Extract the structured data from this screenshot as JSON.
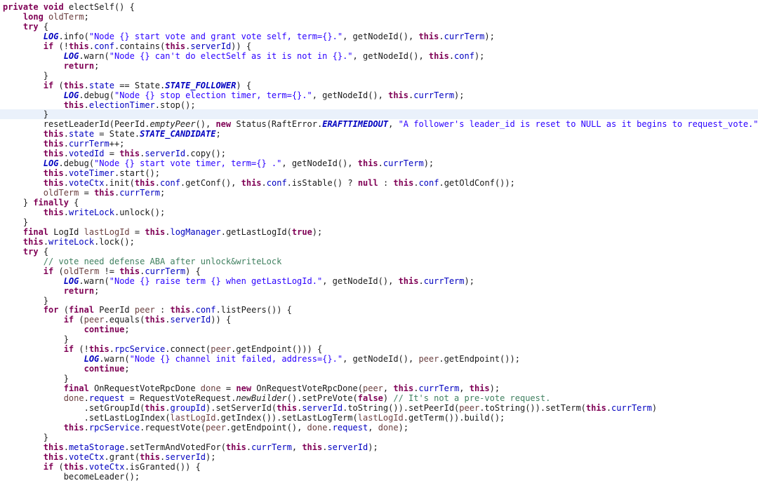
{
  "editor": {
    "language": "java",
    "highlighted_line": 11,
    "colors": {
      "keyword": "#7f0055",
      "field": "#0000c0",
      "string": "#2a00ff",
      "comment": "#3f7f5f",
      "local_variable": "#6a3e3e",
      "current_line": "#eaf1fb"
    },
    "lines": [
      [
        [
          "kw",
          "private void "
        ],
        [
          "pl",
          "electSelf() {"
        ]
      ],
      [
        [
          "pl",
          "    "
        ],
        [
          "kw",
          "long "
        ],
        [
          "lv",
          "oldTerm"
        ],
        [
          "pl",
          ";"
        ]
      ],
      [
        [
          "pl",
          "    "
        ],
        [
          "kw",
          "try "
        ],
        [
          "pl",
          "{"
        ]
      ],
      [
        [
          "pl",
          "        "
        ],
        [
          "sfld",
          "LOG"
        ],
        [
          "pl",
          ".info("
        ],
        [
          "str",
          "\"Node {} start vote and grant vote self, term={}.\""
        ],
        [
          "pl",
          ", getNodeId(), "
        ],
        [
          "kw",
          "this"
        ],
        [
          "pl",
          "."
        ],
        [
          "fld",
          "currTerm"
        ],
        [
          "pl",
          ");"
        ]
      ],
      [
        [
          "pl",
          "        "
        ],
        [
          "kw",
          "if "
        ],
        [
          "pl",
          "(!"
        ],
        [
          "kw",
          "this"
        ],
        [
          "pl",
          "."
        ],
        [
          "fld",
          "conf"
        ],
        [
          "pl",
          ".contains("
        ],
        [
          "kw",
          "this"
        ],
        [
          "pl",
          "."
        ],
        [
          "fld",
          "serverId"
        ],
        [
          "pl",
          ")) {"
        ]
      ],
      [
        [
          "pl",
          "            "
        ],
        [
          "sfld",
          "LOG"
        ],
        [
          "pl",
          ".warn("
        ],
        [
          "str",
          "\"Node {} can't do electSelf as it is not in {}.\""
        ],
        [
          "pl",
          ", getNodeId(), "
        ],
        [
          "kw",
          "this"
        ],
        [
          "pl",
          "."
        ],
        [
          "fld",
          "conf"
        ],
        [
          "pl",
          ");"
        ]
      ],
      [
        [
          "pl",
          "            "
        ],
        [
          "kw",
          "return"
        ],
        [
          "pl",
          ";"
        ]
      ],
      [
        [
          "pl",
          "        }"
        ]
      ],
      [
        [
          "pl",
          "        "
        ],
        [
          "kw",
          "if "
        ],
        [
          "pl",
          "("
        ],
        [
          "kw",
          "this"
        ],
        [
          "pl",
          "."
        ],
        [
          "fld",
          "state"
        ],
        [
          "pl",
          " == State."
        ],
        [
          "sfld",
          "STATE_FOLLOWER"
        ],
        [
          "pl",
          ") {"
        ]
      ],
      [
        [
          "pl",
          "            "
        ],
        [
          "sfld",
          "LOG"
        ],
        [
          "pl",
          ".debug("
        ],
        [
          "str",
          "\"Node {} stop election timer, term={}.\""
        ],
        [
          "pl",
          ", getNodeId(), "
        ],
        [
          "kw",
          "this"
        ],
        [
          "pl",
          "."
        ],
        [
          "fld",
          "currTerm"
        ],
        [
          "pl",
          ");"
        ]
      ],
      [
        [
          "pl",
          "            "
        ],
        [
          "kw",
          "this"
        ],
        [
          "pl",
          "."
        ],
        [
          "fld",
          "electionTimer"
        ],
        [
          "pl",
          ".stop();"
        ]
      ],
      [
        [
          "pl",
          "        }"
        ]
      ],
      [
        [
          "pl",
          "        resetLeaderId(PeerId."
        ],
        [
          "it",
          "emptyPeer"
        ],
        [
          "pl",
          "(), "
        ],
        [
          "kw",
          "new "
        ],
        [
          "pl",
          "Status(RaftError."
        ],
        [
          "sfld",
          "ERAFTTIMEDOUT"
        ],
        [
          "pl",
          ", "
        ],
        [
          "str",
          "\"A follower's leader_id is reset to NULL as it begins to request_vote.\""
        ],
        [
          "pl",
          "));"
        ]
      ],
      [
        [
          "pl",
          "        "
        ],
        [
          "kw",
          "this"
        ],
        [
          "pl",
          "."
        ],
        [
          "fld",
          "state"
        ],
        [
          "pl",
          " = State."
        ],
        [
          "sfld",
          "STATE_CANDIDATE"
        ],
        [
          "pl",
          ";"
        ]
      ],
      [
        [
          "pl",
          "        "
        ],
        [
          "kw",
          "this"
        ],
        [
          "pl",
          "."
        ],
        [
          "fld",
          "currTerm"
        ],
        [
          "pl",
          "++;"
        ]
      ],
      [
        [
          "pl",
          "        "
        ],
        [
          "kw",
          "this"
        ],
        [
          "pl",
          "."
        ],
        [
          "fld",
          "votedId"
        ],
        [
          "pl",
          " = "
        ],
        [
          "kw",
          "this"
        ],
        [
          "pl",
          "."
        ],
        [
          "fld",
          "serverId"
        ],
        [
          "pl",
          ".copy();"
        ]
      ],
      [
        [
          "pl",
          "        "
        ],
        [
          "sfld",
          "LOG"
        ],
        [
          "pl",
          ".debug("
        ],
        [
          "str",
          "\"Node {} start vote timer, term={} .\""
        ],
        [
          "pl",
          ", getNodeId(), "
        ],
        [
          "kw",
          "this"
        ],
        [
          "pl",
          "."
        ],
        [
          "fld",
          "currTerm"
        ],
        [
          "pl",
          ");"
        ]
      ],
      [
        [
          "pl",
          "        "
        ],
        [
          "kw",
          "this"
        ],
        [
          "pl",
          "."
        ],
        [
          "fld",
          "voteTimer"
        ],
        [
          "pl",
          ".start();"
        ]
      ],
      [
        [
          "pl",
          "        "
        ],
        [
          "kw",
          "this"
        ],
        [
          "pl",
          "."
        ],
        [
          "fld",
          "voteCtx"
        ],
        [
          "pl",
          ".init("
        ],
        [
          "kw",
          "this"
        ],
        [
          "pl",
          "."
        ],
        [
          "fld",
          "conf"
        ],
        [
          "pl",
          ".getConf(), "
        ],
        [
          "kw",
          "this"
        ],
        [
          "pl",
          "."
        ],
        [
          "fld",
          "conf"
        ],
        [
          "pl",
          ".isStable() ? "
        ],
        [
          "kw",
          "null"
        ],
        [
          "pl",
          " : "
        ],
        [
          "kw",
          "this"
        ],
        [
          "pl",
          "."
        ],
        [
          "fld",
          "conf"
        ],
        [
          "pl",
          ".getOldConf());"
        ]
      ],
      [
        [
          "pl",
          "        "
        ],
        [
          "lv",
          "oldTerm"
        ],
        [
          "pl",
          " = "
        ],
        [
          "kw",
          "this"
        ],
        [
          "pl",
          "."
        ],
        [
          "fld",
          "currTerm"
        ],
        [
          "pl",
          ";"
        ]
      ],
      [
        [
          "pl",
          "    } "
        ],
        [
          "kw",
          "finally "
        ],
        [
          "pl",
          "{"
        ]
      ],
      [
        [
          "pl",
          "        "
        ],
        [
          "kw",
          "this"
        ],
        [
          "pl",
          "."
        ],
        [
          "fld",
          "writeLock"
        ],
        [
          "pl",
          ".unlock();"
        ]
      ],
      [
        [
          "pl",
          "    }"
        ]
      ],
      [
        [
          "pl",
          "    "
        ],
        [
          "kw",
          "final "
        ],
        [
          "pl",
          "LogId "
        ],
        [
          "lv",
          "lastLogId"
        ],
        [
          "pl",
          " = "
        ],
        [
          "kw",
          "this"
        ],
        [
          "pl",
          "."
        ],
        [
          "fld",
          "logManager"
        ],
        [
          "pl",
          ".getLastLogId("
        ],
        [
          "kw",
          "true"
        ],
        [
          "pl",
          ");"
        ]
      ],
      [
        [
          "pl",
          "    "
        ],
        [
          "kw",
          "this"
        ],
        [
          "pl",
          "."
        ],
        [
          "fld",
          "writeLock"
        ],
        [
          "pl",
          ".lock();"
        ]
      ],
      [
        [
          "pl",
          "    "
        ],
        [
          "kw",
          "try "
        ],
        [
          "pl",
          "{"
        ]
      ],
      [
        [
          "pl",
          "        "
        ],
        [
          "cm",
          "// vote need defense ABA after unlock&writeLock"
        ]
      ],
      [
        [
          "pl",
          "        "
        ],
        [
          "kw",
          "if "
        ],
        [
          "pl",
          "("
        ],
        [
          "lv",
          "oldTerm"
        ],
        [
          "pl",
          " != "
        ],
        [
          "kw",
          "this"
        ],
        [
          "pl",
          "."
        ],
        [
          "fld",
          "currTerm"
        ],
        [
          "pl",
          ") {"
        ]
      ],
      [
        [
          "pl",
          "            "
        ],
        [
          "sfld",
          "LOG"
        ],
        [
          "pl",
          ".warn("
        ],
        [
          "str",
          "\"Node {} raise term {} when getLastLogId.\""
        ],
        [
          "pl",
          ", getNodeId(), "
        ],
        [
          "kw",
          "this"
        ],
        [
          "pl",
          "."
        ],
        [
          "fld",
          "currTerm"
        ],
        [
          "pl",
          ");"
        ]
      ],
      [
        [
          "pl",
          "            "
        ],
        [
          "kw",
          "return"
        ],
        [
          "pl",
          ";"
        ]
      ],
      [
        [
          "pl",
          "        }"
        ]
      ],
      [
        [
          "pl",
          "        "
        ],
        [
          "kw",
          "for "
        ],
        [
          "pl",
          "("
        ],
        [
          "kw",
          "final "
        ],
        [
          "pl",
          "PeerId "
        ],
        [
          "lv",
          "peer"
        ],
        [
          "pl",
          " : "
        ],
        [
          "kw",
          "this"
        ],
        [
          "pl",
          "."
        ],
        [
          "fld",
          "conf"
        ],
        [
          "pl",
          ".listPeers()) {"
        ]
      ],
      [
        [
          "pl",
          "            "
        ],
        [
          "kw",
          "if "
        ],
        [
          "pl",
          "("
        ],
        [
          "lv",
          "peer"
        ],
        [
          "pl",
          ".equals("
        ],
        [
          "kw",
          "this"
        ],
        [
          "pl",
          "."
        ],
        [
          "fld",
          "serverId"
        ],
        [
          "pl",
          ")) {"
        ]
      ],
      [
        [
          "pl",
          "                "
        ],
        [
          "kw",
          "continue"
        ],
        [
          "pl",
          ";"
        ]
      ],
      [
        [
          "pl",
          "            }"
        ]
      ],
      [
        [
          "pl",
          "            "
        ],
        [
          "kw",
          "if "
        ],
        [
          "pl",
          "(!"
        ],
        [
          "kw",
          "this"
        ],
        [
          "pl",
          "."
        ],
        [
          "fld",
          "rpcService"
        ],
        [
          "pl",
          ".connect("
        ],
        [
          "lv",
          "peer"
        ],
        [
          "pl",
          ".getEndpoint())) {"
        ]
      ],
      [
        [
          "pl",
          "                "
        ],
        [
          "sfld",
          "LOG"
        ],
        [
          "pl",
          ".warn("
        ],
        [
          "str",
          "\"Node {} channel init failed, address={}.\""
        ],
        [
          "pl",
          ", getNodeId(), "
        ],
        [
          "lv",
          "peer"
        ],
        [
          "pl",
          ".getEndpoint());"
        ]
      ],
      [
        [
          "pl",
          "                "
        ],
        [
          "kw",
          "continue"
        ],
        [
          "pl",
          ";"
        ]
      ],
      [
        [
          "pl",
          "            }"
        ]
      ],
      [
        [
          "pl",
          "            "
        ],
        [
          "kw",
          "final "
        ],
        [
          "pl",
          "OnRequestVoteRpcDone "
        ],
        [
          "lv",
          "done"
        ],
        [
          "pl",
          " = "
        ],
        [
          "kw",
          "new "
        ],
        [
          "pl",
          "OnRequestVoteRpcDone("
        ],
        [
          "lv",
          "peer"
        ],
        [
          "pl",
          ", "
        ],
        [
          "kw",
          "this"
        ],
        [
          "pl",
          "."
        ],
        [
          "fld",
          "currTerm"
        ],
        [
          "pl",
          ", "
        ],
        [
          "kw",
          "this"
        ],
        [
          "pl",
          ");"
        ]
      ],
      [
        [
          "pl",
          "            "
        ],
        [
          "lv",
          "done"
        ],
        [
          "pl",
          "."
        ],
        [
          "fld",
          "request"
        ],
        [
          "pl",
          " = RequestVoteRequest."
        ],
        [
          "it",
          "newBuilder"
        ],
        [
          "pl",
          "().setPreVote("
        ],
        [
          "kw",
          "false"
        ],
        [
          "pl",
          ") "
        ],
        [
          "cm",
          "// It's not a pre-vote request."
        ]
      ],
      [
        [
          "pl",
          "                .setGroupId("
        ],
        [
          "kw",
          "this"
        ],
        [
          "pl",
          "."
        ],
        [
          "fld",
          "groupId"
        ],
        [
          "pl",
          ").setServerId("
        ],
        [
          "kw",
          "this"
        ],
        [
          "pl",
          "."
        ],
        [
          "fld",
          "serverId"
        ],
        [
          "pl",
          ".toString()).setPeerId("
        ],
        [
          "lv",
          "peer"
        ],
        [
          "pl",
          ".toString()).setTerm("
        ],
        [
          "kw",
          "this"
        ],
        [
          "pl",
          "."
        ],
        [
          "fld",
          "currTerm"
        ],
        [
          "pl",
          ")"
        ]
      ],
      [
        [
          "pl",
          "                .setLastLogIndex("
        ],
        [
          "lv",
          "lastLogId"
        ],
        [
          "pl",
          ".getIndex()).setLastLogTerm("
        ],
        [
          "lv",
          "lastLogId"
        ],
        [
          "pl",
          ".getTerm()).build();"
        ]
      ],
      [
        [
          "pl",
          "            "
        ],
        [
          "kw",
          "this"
        ],
        [
          "pl",
          "."
        ],
        [
          "fld",
          "rpcService"
        ],
        [
          "pl",
          ".requestVote("
        ],
        [
          "lv",
          "peer"
        ],
        [
          "pl",
          ".getEndpoint(), "
        ],
        [
          "lv",
          "done"
        ],
        [
          "pl",
          "."
        ],
        [
          "fld",
          "request"
        ],
        [
          "pl",
          ", "
        ],
        [
          "lv",
          "done"
        ],
        [
          "pl",
          ");"
        ]
      ],
      [
        [
          "pl",
          "        }"
        ]
      ],
      [
        [
          "pl",
          "        "
        ],
        [
          "kw",
          "this"
        ],
        [
          "pl",
          "."
        ],
        [
          "fld",
          "metaStorage"
        ],
        [
          "pl",
          ".setTermAndVotedFor("
        ],
        [
          "kw",
          "this"
        ],
        [
          "pl",
          "."
        ],
        [
          "fld",
          "currTerm"
        ],
        [
          "pl",
          ", "
        ],
        [
          "kw",
          "this"
        ],
        [
          "pl",
          "."
        ],
        [
          "fld",
          "serverId"
        ],
        [
          "pl",
          ");"
        ]
      ],
      [
        [
          "pl",
          "        "
        ],
        [
          "kw",
          "this"
        ],
        [
          "pl",
          "."
        ],
        [
          "fld",
          "voteCtx"
        ],
        [
          "pl",
          ".grant("
        ],
        [
          "kw",
          "this"
        ],
        [
          "pl",
          "."
        ],
        [
          "fld",
          "serverId"
        ],
        [
          "pl",
          ");"
        ]
      ],
      [
        [
          "pl",
          "        "
        ],
        [
          "kw",
          "if "
        ],
        [
          "pl",
          "("
        ],
        [
          "kw",
          "this"
        ],
        [
          "pl",
          "."
        ],
        [
          "fld",
          "voteCtx"
        ],
        [
          "pl",
          ".isGranted()) {"
        ]
      ],
      [
        [
          "pl",
          "            becomeLeader();"
        ]
      ]
    ]
  }
}
